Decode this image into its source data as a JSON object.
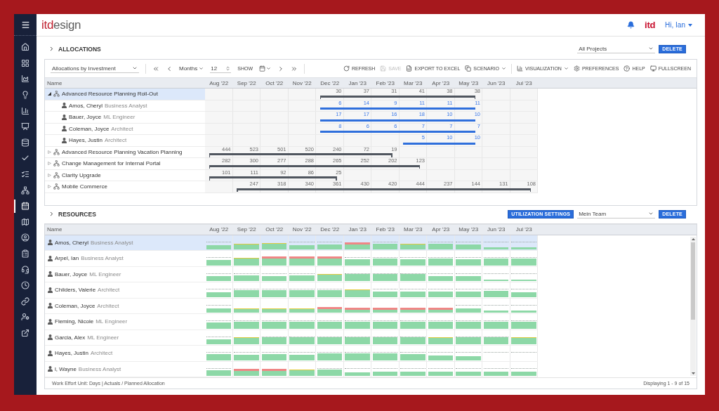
{
  "sidebar": {
    "items": [
      {
        "selected": false
      },
      {
        "selected": false
      },
      {
        "selected": false
      },
      {
        "selected": false
      },
      {
        "selected": false
      },
      {
        "selected": false
      },
      {
        "selected": false
      },
      {
        "selected": false
      },
      {
        "selected": false
      },
      {
        "selected": false
      },
      {
        "selected": true
      },
      {
        "selected": false
      },
      {
        "selected": false
      },
      {
        "selected": false
      },
      {
        "selected": false
      },
      {
        "selected": false
      },
      {
        "selected": false
      },
      {
        "selected": false
      },
      {
        "selected": false
      }
    ]
  },
  "header": {
    "logo": {
      "accent": "itd",
      "rest": "esign"
    },
    "brand": "itd",
    "user_menu": "Hi, Ian"
  },
  "allocations": {
    "title": "ALLOCATIONS",
    "filter": {
      "value": "All Projects"
    },
    "delete_button": "DELETE",
    "toolbar": {
      "view_select": {
        "value": "Allocations by Investment"
      },
      "period_unit": {
        "value": "Months"
      },
      "period_count": {
        "value": "12"
      },
      "show_label": "SHOW",
      "action_groups": [
        {
          "actions": [
            {
              "label": "REFRESH",
              "disabled": false,
              "menu": false
            },
            {
              "label": "SAVE",
              "disabled": true,
              "menu": false
            },
            {
              "label": "EXPORT TO EXCEL",
              "disabled": false,
              "menu": false
            },
            {
              "label": "SCENARIO",
              "disabled": false,
              "menu": true
            }
          ]
        },
        {
          "actions": [
            {
              "label": "VISUALIZATION",
              "disabled": false,
              "menu": true
            },
            {
              "label": "PREFERENCES",
              "disabled": false,
              "menu": false
            },
            {
              "label": "HELP",
              "disabled": false,
              "menu": false
            },
            {
              "label": "FULLSCREEN",
              "disabled": false,
              "menu": false
            }
          ]
        }
      ]
    },
    "name_header": "Name",
    "months": [
      "Aug '22",
      "Sep '22",
      "Oct '22",
      "Nov '22",
      "Dec '22",
      "Jan '23",
      "Feb '23",
      "Mar '23",
      "Apr '23",
      "May '23",
      "Jun '23",
      "Jul '23"
    ],
    "rows": [
      {
        "name": "Advanced Resource Planning Roll-Out",
        "expanded": true,
        "selected": true,
        "cells": [
          {
            "kind": "blank"
          },
          {
            "kind": "blank"
          },
          {
            "kind": "blank"
          },
          {
            "kind": "blank"
          },
          {
            "kind": "value",
            "value": "30"
          },
          {
            "kind": "value",
            "value": "37"
          },
          {
            "kind": "value",
            "value": "31"
          },
          {
            "kind": "value",
            "value": "41"
          },
          {
            "kind": "value",
            "value": "38"
          },
          {
            "kind": "value",
            "value": "38"
          },
          {
            "kind": "blank"
          },
          {
            "kind": "blank"
          }
        ],
        "children": [
          {
            "name": "Amos, Cheryl",
            "role": "Business Analyst",
            "selected": false,
            "cells": [
              {
                "kind": "blank"
              },
              {
                "kind": "blank"
              },
              {
                "kind": "blank"
              },
              {
                "kind": "blank"
              },
              {
                "kind": "value",
                "value": "6"
              },
              {
                "kind": "value",
                "value": "14"
              },
              {
                "kind": "value",
                "value": "9"
              },
              {
                "kind": "value",
                "value": "11"
              },
              {
                "kind": "value",
                "value": "11"
              },
              {
                "kind": "value",
                "value": "11"
              },
              {
                "kind": "blank"
              },
              {
                "kind": "blank"
              }
            ]
          },
          {
            "name": "Bauer, Joyce",
            "role": "ML Engineer",
            "selected": false,
            "cells": [
              {
                "kind": "blank"
              },
              {
                "kind": "blank"
              },
              {
                "kind": "blank"
              },
              {
                "kind": "blank"
              },
              {
                "kind": "value",
                "value": "17"
              },
              {
                "kind": "value",
                "value": "17"
              },
              {
                "kind": "value",
                "value": "16"
              },
              {
                "kind": "value",
                "value": "18"
              },
              {
                "kind": "value",
                "value": "10"
              },
              {
                "kind": "value",
                "value": "10"
              },
              {
                "kind": "blank"
              },
              {
                "kind": "blank"
              }
            ]
          },
          {
            "name": "Coleman, Joyce",
            "role": "Architect",
            "selected": false,
            "cells": [
              {
                "kind": "blank"
              },
              {
                "kind": "blank"
              },
              {
                "kind": "blank"
              },
              {
                "kind": "blank"
              },
              {
                "kind": "value",
                "value": "8"
              },
              {
                "kind": "value",
                "value": "6"
              },
              {
                "kind": "value",
                "value": "6"
              },
              {
                "kind": "value",
                "value": "7"
              },
              {
                "kind": "value",
                "value": "7"
              },
              {
                "kind": "value",
                "value": "7"
              },
              {
                "kind": "blank"
              },
              {
                "kind": "blank"
              }
            ]
          },
          {
            "name": "Hayes, Justin",
            "role": "Architect",
            "selected": false,
            "cells": [
              {
                "kind": "blank"
              },
              {
                "kind": "blank"
              },
              {
                "kind": "blank"
              },
              {
                "kind": "blank"
              },
              {
                "kind": "blank"
              },
              {
                "kind": "blank"
              },
              {
                "kind": "blank"
              },
              {
                "kind": "value",
                "value": "5"
              },
              {
                "kind": "value",
                "value": "10"
              },
              {
                "kind": "value",
                "value": "10"
              },
              {
                "kind": "blank"
              },
              {
                "kind": "blank"
              }
            ]
          }
        ]
      },
      {
        "name": "Advanced Resource Planning Vacation Planning",
        "expanded": false,
        "selected": false,
        "cells": [
          {
            "kind": "value",
            "value": "444"
          },
          {
            "kind": "value",
            "value": "523"
          },
          {
            "kind": "value",
            "value": "501"
          },
          {
            "kind": "value",
            "value": "520"
          },
          {
            "kind": "value",
            "value": "240"
          },
          {
            "kind": "value",
            "value": "72"
          },
          {
            "kind": "value",
            "value": "19"
          },
          {
            "kind": "blank"
          },
          {
            "kind": "blank"
          },
          {
            "kind": "blank"
          },
          {
            "kind": "blank"
          },
          {
            "kind": "blank"
          }
        ]
      },
      {
        "name": "Change Management for Internal Portal",
        "expanded": false,
        "selected": false,
        "cells": [
          {
            "kind": "value",
            "value": "282"
          },
          {
            "kind": "value",
            "value": "300"
          },
          {
            "kind": "value",
            "value": "277"
          },
          {
            "kind": "value",
            "value": "288"
          },
          {
            "kind": "value",
            "value": "265"
          },
          {
            "kind": "value",
            "value": "252"
          },
          {
            "kind": "value",
            "value": "202"
          },
          {
            "kind": "value",
            "value": "123"
          },
          {
            "kind": "blank"
          },
          {
            "kind": "blank"
          },
          {
            "kind": "blank"
          },
          {
            "kind": "blank"
          }
        ]
      },
      {
        "name": "Clarity Upgrade",
        "expanded": false,
        "selected": false,
        "cells": [
          {
            "kind": "value",
            "value": "101"
          },
          {
            "kind": "value",
            "value": "111"
          },
          {
            "kind": "value",
            "value": "92"
          },
          {
            "kind": "value",
            "value": "86"
          },
          {
            "kind": "value",
            "value": "25"
          },
          {
            "kind": "blank"
          },
          {
            "kind": "blank"
          },
          {
            "kind": "blank"
          },
          {
            "kind": "blank"
          },
          {
            "kind": "blank"
          },
          {
            "kind": "blank"
          },
          {
            "kind": "blank"
          }
        ]
      },
      {
        "name": "Mobile Commerce",
        "expanded": false,
        "selected": false,
        "cells": [
          {
            "kind": "blank"
          },
          {
            "kind": "value",
            "value": "247"
          },
          {
            "kind": "value",
            "value": "318"
          },
          {
            "kind": "value",
            "value": "340"
          },
          {
            "kind": "value",
            "value": "361"
          },
          {
            "kind": "value",
            "value": "430"
          },
          {
            "kind": "value",
            "value": "420"
          },
          {
            "kind": "value",
            "value": "444"
          },
          {
            "kind": "value",
            "value": "237"
          },
          {
            "kind": "value",
            "value": "144"
          },
          {
            "kind": "value",
            "value": "131"
          },
          {
            "kind": "value",
            "value": "108"
          }
        ]
      }
    ]
  },
  "resources": {
    "title": "RESOURCES",
    "settings_button": "UTILIZATION SETTINGS",
    "filter": {
      "value": "Mein Team"
    },
    "delete_button": "DELETE",
    "name_header": "Name",
    "months": [
      "Aug '22",
      "Sep '22",
      "Oct '22",
      "Nov '22",
      "Dec '22",
      "Jan '23",
      "Feb '23",
      "Mar '23",
      "Apr '23",
      "May '23",
      "Jun '23",
      "Jul '23"
    ],
    "rows": [
      {
        "name": "Amos, Cheryl",
        "role": "Business Analyst",
        "selected": true
      },
      {
        "name": "Arpel, Ian",
        "role": "Business Analyst",
        "selected": false
      },
      {
        "name": "Bauer, Joyce",
        "role": "ML Engineer",
        "selected": false
      },
      {
        "name": "Childers, Valerie",
        "role": "Architect",
        "selected": false
      },
      {
        "name": "Coleman, Joyce",
        "role": "Architect",
        "selected": false
      },
      {
        "name": "Fleming, Nicole",
        "role": "ML Engineer",
        "selected": false
      },
      {
        "name": "Garcia, Alex",
        "role": "ML Engineer",
        "selected": false
      },
      {
        "name": "Hayes, Justin",
        "role": "Architect",
        "selected": false
      },
      {
        "name": "l, Wayne",
        "role": "Business Analyst",
        "selected": false
      }
    ],
    "footer": {
      "legend": "Work Effort Unit: Days | Actuals / Planned Allocation",
      "paging": "Displaying 1 - 9 of 15"
    }
  }
}
